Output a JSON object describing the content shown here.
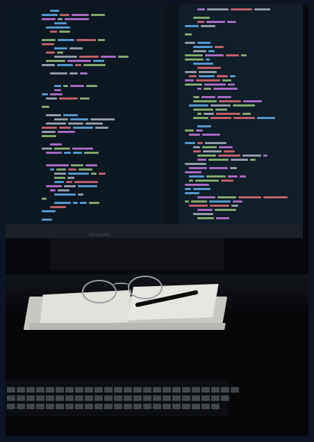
{
  "scene": {
    "alt": "",
    "monitor_brand": "ViewSonic"
  },
  "colors": {
    "frame": "#0d1525",
    "screen": "#0f1a24",
    "code_keyword": "#c678dd",
    "code_string": "#98c379",
    "code_function": "#61afef",
    "code_variable": "#e06c75",
    "code_text": "#abb2bf",
    "paper": "#e3e1dc"
  }
}
